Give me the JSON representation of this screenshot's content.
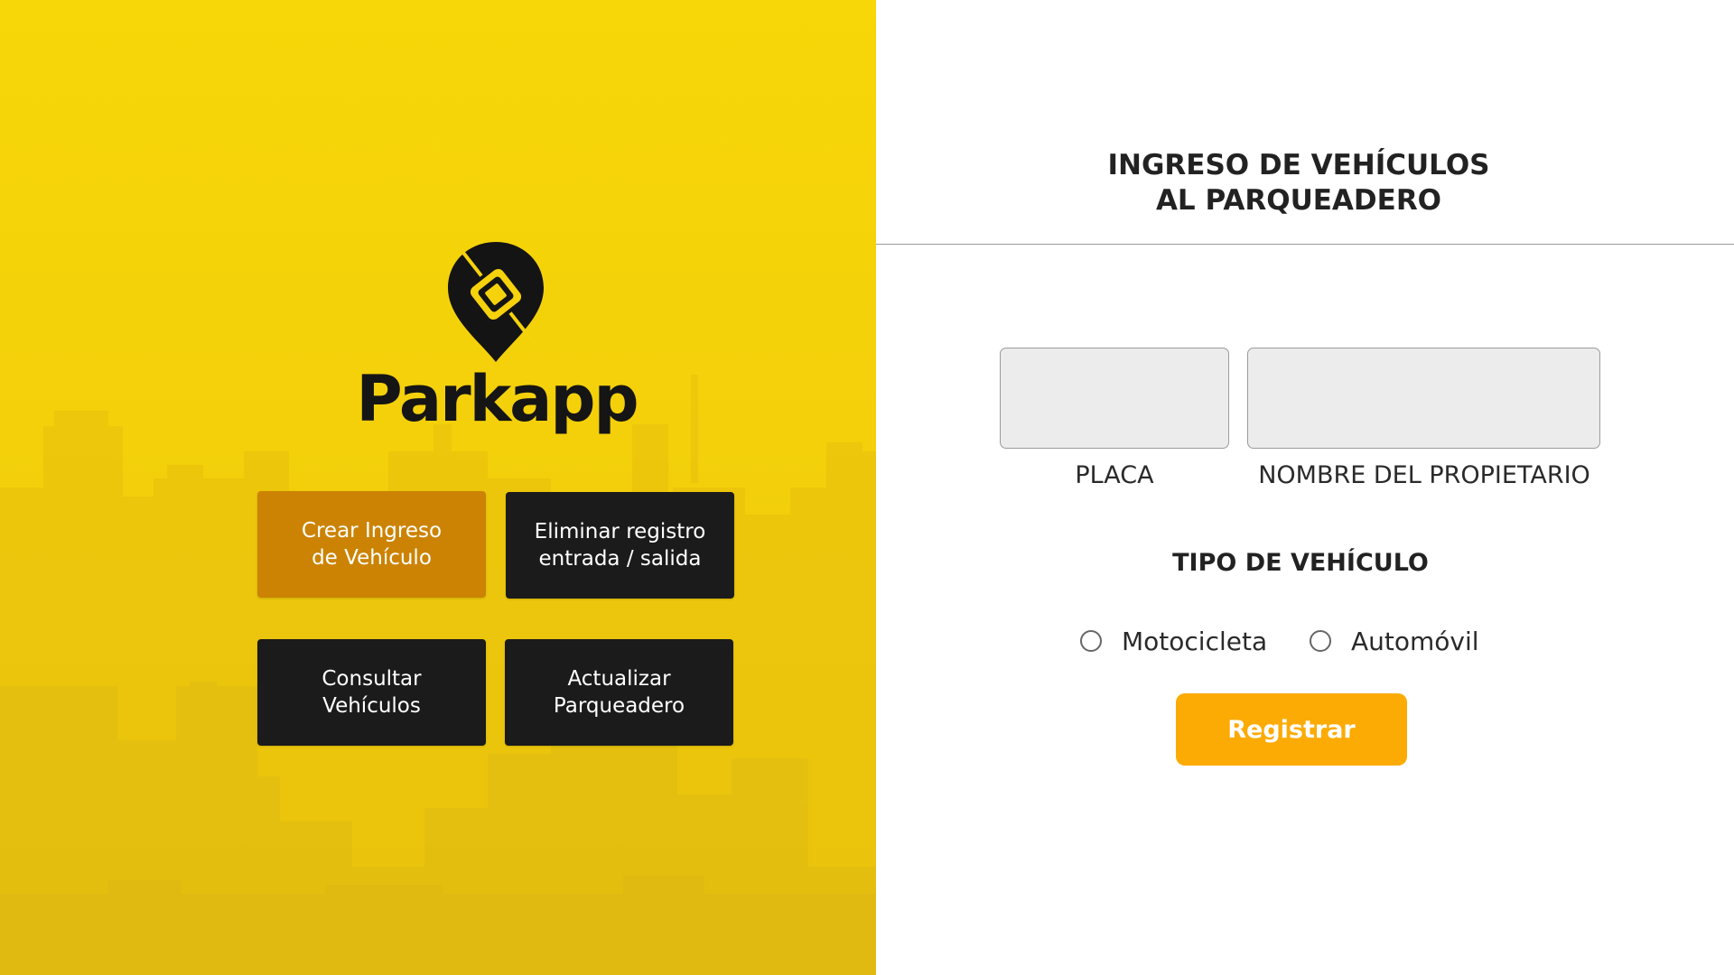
{
  "brand": {
    "name": "Parkapp",
    "logo_icon": "map-pin-car-icon",
    "colors": {
      "primary_yellow": "#f7d708",
      "skyline_yellow": "#e8c20e",
      "dark": "#1b1b1b",
      "active_orange": "#cc8303"
    }
  },
  "menu": {
    "buttons": [
      {
        "label": "Crear Ingreso\nde Vehículo",
        "state": "active"
      },
      {
        "label": "Eliminar registro\nentrada / salida",
        "state": "default"
      },
      {
        "label": "Consultar\nVehículos",
        "state": "default"
      },
      {
        "label": "Actualizar\nParqueadero",
        "state": "default"
      }
    ]
  },
  "form": {
    "title": "INGRESO DE VEHÍCULOS\nAL PARQUEADERO",
    "fields": {
      "placa": {
        "label": "PLACA",
        "value": "",
        "placeholder": ""
      },
      "nombre": {
        "label": "NOMBRE DEL PROPIETARIO",
        "value": "",
        "placeholder": ""
      }
    },
    "vehicle_type": {
      "title": "TIPO DE VEHÍCULO",
      "options": [
        {
          "label": "Motocicleta",
          "selected": false
        },
        {
          "label": "Automóvil",
          "selected": false
        }
      ]
    },
    "submit": {
      "label": "Registrar",
      "color": "#fcab04"
    }
  }
}
